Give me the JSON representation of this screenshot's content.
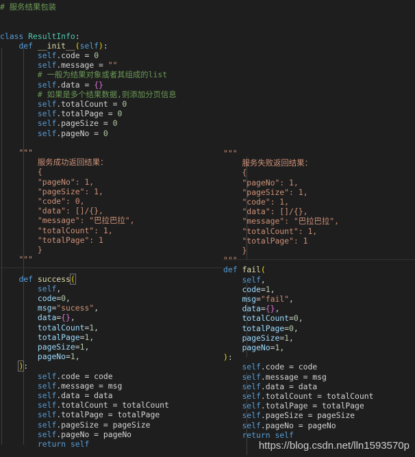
{
  "header_comment": "# 服务结果包装",
  "colors": {
    "background": "#1e1e1e",
    "keyword": "#569cd6",
    "function": "#dcdcaa",
    "class": "#4ec9b0",
    "string": "#ce9178",
    "number": "#b5cea8",
    "comment": "#6a9955",
    "brace": "#da70d6",
    "paren": "#ffd700"
  },
  "left_code": [
    [
      [
        "cmt",
        "# 服务结果包装"
      ]
    ],
    [],
    [],
    [
      [
        "kw",
        "class "
      ],
      [
        "cls",
        "ResultInfo"
      ],
      [
        "plain",
        ":"
      ]
    ],
    [
      [
        "plain",
        "    "
      ],
      [
        "kw",
        "def "
      ],
      [
        "fn",
        "__init__"
      ],
      [
        "par",
        "("
      ],
      [
        "self",
        "self"
      ],
      [
        "par",
        ")"
      ],
      [
        "plain",
        ":"
      ]
    ],
    [
      [
        "plain",
        "        "
      ],
      [
        "self",
        "self"
      ],
      [
        "plain",
        ".code = "
      ],
      [
        "num",
        "0"
      ]
    ],
    [
      [
        "plain",
        "        "
      ],
      [
        "self",
        "self"
      ],
      [
        "plain",
        ".message = "
      ],
      [
        "str",
        "\"\""
      ]
    ],
    [
      [
        "plain",
        "        "
      ],
      [
        "cmt",
        "# 一般为结果对象或者其组成的list"
      ]
    ],
    [
      [
        "plain",
        "        "
      ],
      [
        "self",
        "self"
      ],
      [
        "plain",
        ".data = "
      ],
      [
        "brace",
        "{}"
      ]
    ],
    [
      [
        "plain",
        "        "
      ],
      [
        "cmt",
        "# 如果是多个结果数据,则添加分页信息"
      ]
    ],
    [
      [
        "plain",
        "        "
      ],
      [
        "self",
        "self"
      ],
      [
        "plain",
        ".totalCount = "
      ],
      [
        "num",
        "0"
      ]
    ],
    [
      [
        "plain",
        "        "
      ],
      [
        "self",
        "self"
      ],
      [
        "plain",
        ".totalPage = "
      ],
      [
        "num",
        "0"
      ]
    ],
    [
      [
        "plain",
        "        "
      ],
      [
        "self",
        "self"
      ],
      [
        "plain",
        ".pageSize = "
      ],
      [
        "num",
        "0"
      ]
    ],
    [
      [
        "plain",
        "        "
      ],
      [
        "self",
        "self"
      ],
      [
        "plain",
        ".pageNo = "
      ],
      [
        "num",
        "0"
      ]
    ],
    [],
    [
      [
        "plain",
        "    "
      ],
      [
        "doc",
        "\"\"\""
      ]
    ],
    [
      [
        "plain",
        "        "
      ],
      [
        "doc",
        "服务成功返回结果："
      ]
    ],
    [
      [
        "plain",
        "        "
      ],
      [
        "doc",
        "{"
      ]
    ],
    [
      [
        "plain",
        "        "
      ],
      [
        "doc",
        "\"pageNo\": 1,"
      ]
    ],
    [
      [
        "plain",
        "        "
      ],
      [
        "doc",
        "\"pageSize\": 1,"
      ]
    ],
    [
      [
        "plain",
        "        "
      ],
      [
        "doc",
        "\"code\": 0,"
      ]
    ],
    [
      [
        "plain",
        "        "
      ],
      [
        "doc",
        "\"data\": []/{},"
      ]
    ],
    [
      [
        "plain",
        "        "
      ],
      [
        "doc",
        "\"message\": \"巴拉巴拉\","
      ]
    ],
    [
      [
        "plain",
        "        "
      ],
      [
        "doc",
        "\"totalCount\": 1,"
      ]
    ],
    [
      [
        "plain",
        "        "
      ],
      [
        "doc",
        "\"totalPage\": 1"
      ]
    ],
    [
      [
        "plain",
        "        "
      ],
      [
        "doc",
        "}"
      ]
    ],
    [
      [
        "plain",
        "    "
      ],
      [
        "doc",
        "\"\"\""
      ]
    ],
    [],
    [
      [
        "plain",
        "    "
      ],
      [
        "kw",
        "def "
      ],
      [
        "fn",
        "success"
      ],
      [
        "parbox",
        "("
      ]
    ],
    [
      [
        "plain",
        "        "
      ],
      [
        "self",
        "self"
      ],
      [
        "plain",
        ","
      ]
    ],
    [
      [
        "plain",
        "        "
      ],
      [
        "param",
        "code"
      ],
      [
        "plain",
        "="
      ],
      [
        "num",
        "0"
      ],
      [
        "plain",
        ","
      ]
    ],
    [
      [
        "plain",
        "        "
      ],
      [
        "param",
        "msg"
      ],
      [
        "plain",
        "="
      ],
      [
        "str",
        "\"sucess\""
      ],
      [
        "plain",
        ","
      ]
    ],
    [
      [
        "plain",
        "        "
      ],
      [
        "param",
        "data"
      ],
      [
        "plain",
        "="
      ],
      [
        "brace",
        "{}"
      ],
      [
        "plain",
        ","
      ]
    ],
    [
      [
        "plain",
        "        "
      ],
      [
        "param",
        "totalCount"
      ],
      [
        "plain",
        "="
      ],
      [
        "num",
        "1"
      ],
      [
        "plain",
        ","
      ]
    ],
    [
      [
        "plain",
        "        "
      ],
      [
        "param",
        "totalPage"
      ],
      [
        "plain",
        "="
      ],
      [
        "num",
        "1"
      ],
      [
        "plain",
        ","
      ]
    ],
    [
      [
        "plain",
        "        "
      ],
      [
        "param",
        "pageSize"
      ],
      [
        "plain",
        "="
      ],
      [
        "num",
        "1"
      ],
      [
        "plain",
        ","
      ]
    ],
    [
      [
        "plain",
        "        "
      ],
      [
        "param",
        "pageNo"
      ],
      [
        "plain",
        "="
      ],
      [
        "num",
        "1"
      ],
      [
        "plain",
        ","
      ]
    ],
    [
      [
        "plain",
        "    "
      ],
      [
        "parbox",
        ")"
      ],
      [
        "plain",
        ":"
      ]
    ],
    [
      [
        "plain",
        "        "
      ],
      [
        "self",
        "self"
      ],
      [
        "plain",
        ".code = code"
      ]
    ],
    [
      [
        "plain",
        "        "
      ],
      [
        "self",
        "self"
      ],
      [
        "plain",
        ".message = msg"
      ]
    ],
    [
      [
        "plain",
        "        "
      ],
      [
        "self",
        "self"
      ],
      [
        "plain",
        ".data = data"
      ]
    ],
    [
      [
        "plain",
        "        "
      ],
      [
        "self",
        "self"
      ],
      [
        "plain",
        ".totalCount = totalCount"
      ]
    ],
    [
      [
        "plain",
        "        "
      ],
      [
        "self",
        "self"
      ],
      [
        "plain",
        ".totalPage = totalPage"
      ]
    ],
    [
      [
        "plain",
        "        "
      ],
      [
        "self",
        "self"
      ],
      [
        "plain",
        ".pageSize = pageSize"
      ]
    ],
    [
      [
        "plain",
        "        "
      ],
      [
        "self",
        "self"
      ],
      [
        "plain",
        ".pageNo = pageNo"
      ]
    ],
    [
      [
        "plain",
        "        "
      ],
      [
        "kw",
        "return "
      ],
      [
        "self",
        "self"
      ]
    ]
  ],
  "right_code": [
    [
      [
        "doc",
        "\"\"\""
      ]
    ],
    [
      [
        "plain",
        "    "
      ],
      [
        "doc",
        "服务失败返回结果："
      ]
    ],
    [
      [
        "plain",
        "    "
      ],
      [
        "doc",
        "{"
      ]
    ],
    [
      [
        "plain",
        "    "
      ],
      [
        "doc",
        "\"pageNo\": 1,"
      ]
    ],
    [
      [
        "plain",
        "    "
      ],
      [
        "doc",
        "\"pageSize\": 1,"
      ]
    ],
    [
      [
        "plain",
        "    "
      ],
      [
        "doc",
        "\"code\": 1,"
      ]
    ],
    [
      [
        "plain",
        "    "
      ],
      [
        "doc",
        "\"data\": []/{},"
      ]
    ],
    [
      [
        "plain",
        "    "
      ],
      [
        "doc",
        "\"message\": \"巴拉巴拉\","
      ]
    ],
    [
      [
        "plain",
        "    "
      ],
      [
        "doc",
        "\"totalCount\": 1,"
      ]
    ],
    [
      [
        "plain",
        "    "
      ],
      [
        "doc",
        "\"totalPage\": 1"
      ]
    ],
    [
      [
        "plain",
        "    "
      ],
      [
        "doc",
        "}"
      ]
    ],
    [
      [
        "doc",
        "\"\"\""
      ]
    ],
    [
      [
        "kw",
        "def "
      ],
      [
        "fn",
        "fail"
      ],
      [
        "par",
        "("
      ]
    ],
    [
      [
        "plain",
        "    "
      ],
      [
        "self",
        "self"
      ],
      [
        "plain",
        ","
      ]
    ],
    [
      [
        "plain",
        "    "
      ],
      [
        "param",
        "code"
      ],
      [
        "plain",
        "="
      ],
      [
        "num",
        "1"
      ],
      [
        "plain",
        ","
      ]
    ],
    [
      [
        "plain",
        "    "
      ],
      [
        "param",
        "msg"
      ],
      [
        "plain",
        "="
      ],
      [
        "str",
        "\"fail\""
      ],
      [
        "plain",
        ","
      ]
    ],
    [
      [
        "plain",
        "    "
      ],
      [
        "param",
        "data"
      ],
      [
        "plain",
        "="
      ],
      [
        "brace",
        "{}"
      ],
      [
        "plain",
        ","
      ]
    ],
    [
      [
        "plain",
        "    "
      ],
      [
        "param",
        "totalCount"
      ],
      [
        "plain",
        "="
      ],
      [
        "num",
        "0"
      ],
      [
        "plain",
        ","
      ]
    ],
    [
      [
        "plain",
        "    "
      ],
      [
        "param",
        "totalPage"
      ],
      [
        "plain",
        "="
      ],
      [
        "num",
        "0"
      ],
      [
        "plain",
        ","
      ]
    ],
    [
      [
        "plain",
        "    "
      ],
      [
        "param",
        "pageSize"
      ],
      [
        "plain",
        "="
      ],
      [
        "num",
        "1"
      ],
      [
        "plain",
        ","
      ]
    ],
    [
      [
        "plain",
        "    "
      ],
      [
        "param",
        "pageNo"
      ],
      [
        "plain",
        "="
      ],
      [
        "num",
        "1"
      ],
      [
        "plain",
        ","
      ]
    ],
    [
      [
        "par",
        ")"
      ],
      [
        "plain",
        ":"
      ]
    ],
    [
      [
        "plain",
        "    "
      ],
      [
        "self",
        "self"
      ],
      [
        "plain",
        ".code = code"
      ]
    ],
    [
      [
        "plain",
        "    "
      ],
      [
        "self",
        "self"
      ],
      [
        "plain",
        ".message = msg"
      ]
    ],
    [
      [
        "plain",
        "    "
      ],
      [
        "self",
        "self"
      ],
      [
        "plain",
        ".data = data"
      ]
    ],
    [
      [
        "plain",
        "    "
      ],
      [
        "self",
        "self"
      ],
      [
        "plain",
        ".totalCount = totalCount"
      ]
    ],
    [
      [
        "plain",
        "    "
      ],
      [
        "self",
        "self"
      ],
      [
        "plain",
        ".totalPage = totalPage"
      ]
    ],
    [
      [
        "plain",
        "    "
      ],
      [
        "self",
        "self"
      ],
      [
        "plain",
        ".pageSize = pageSize"
      ]
    ],
    [
      [
        "plain",
        "    "
      ],
      [
        "self",
        "self"
      ],
      [
        "plain",
        ".pageNo = pageNo"
      ]
    ],
    [
      [
        "plain",
        "    "
      ],
      [
        "kw",
        "return "
      ],
      [
        "self",
        "self"
      ]
    ]
  ],
  "watermark": "https://blog.csdn.net/lln1593570p"
}
